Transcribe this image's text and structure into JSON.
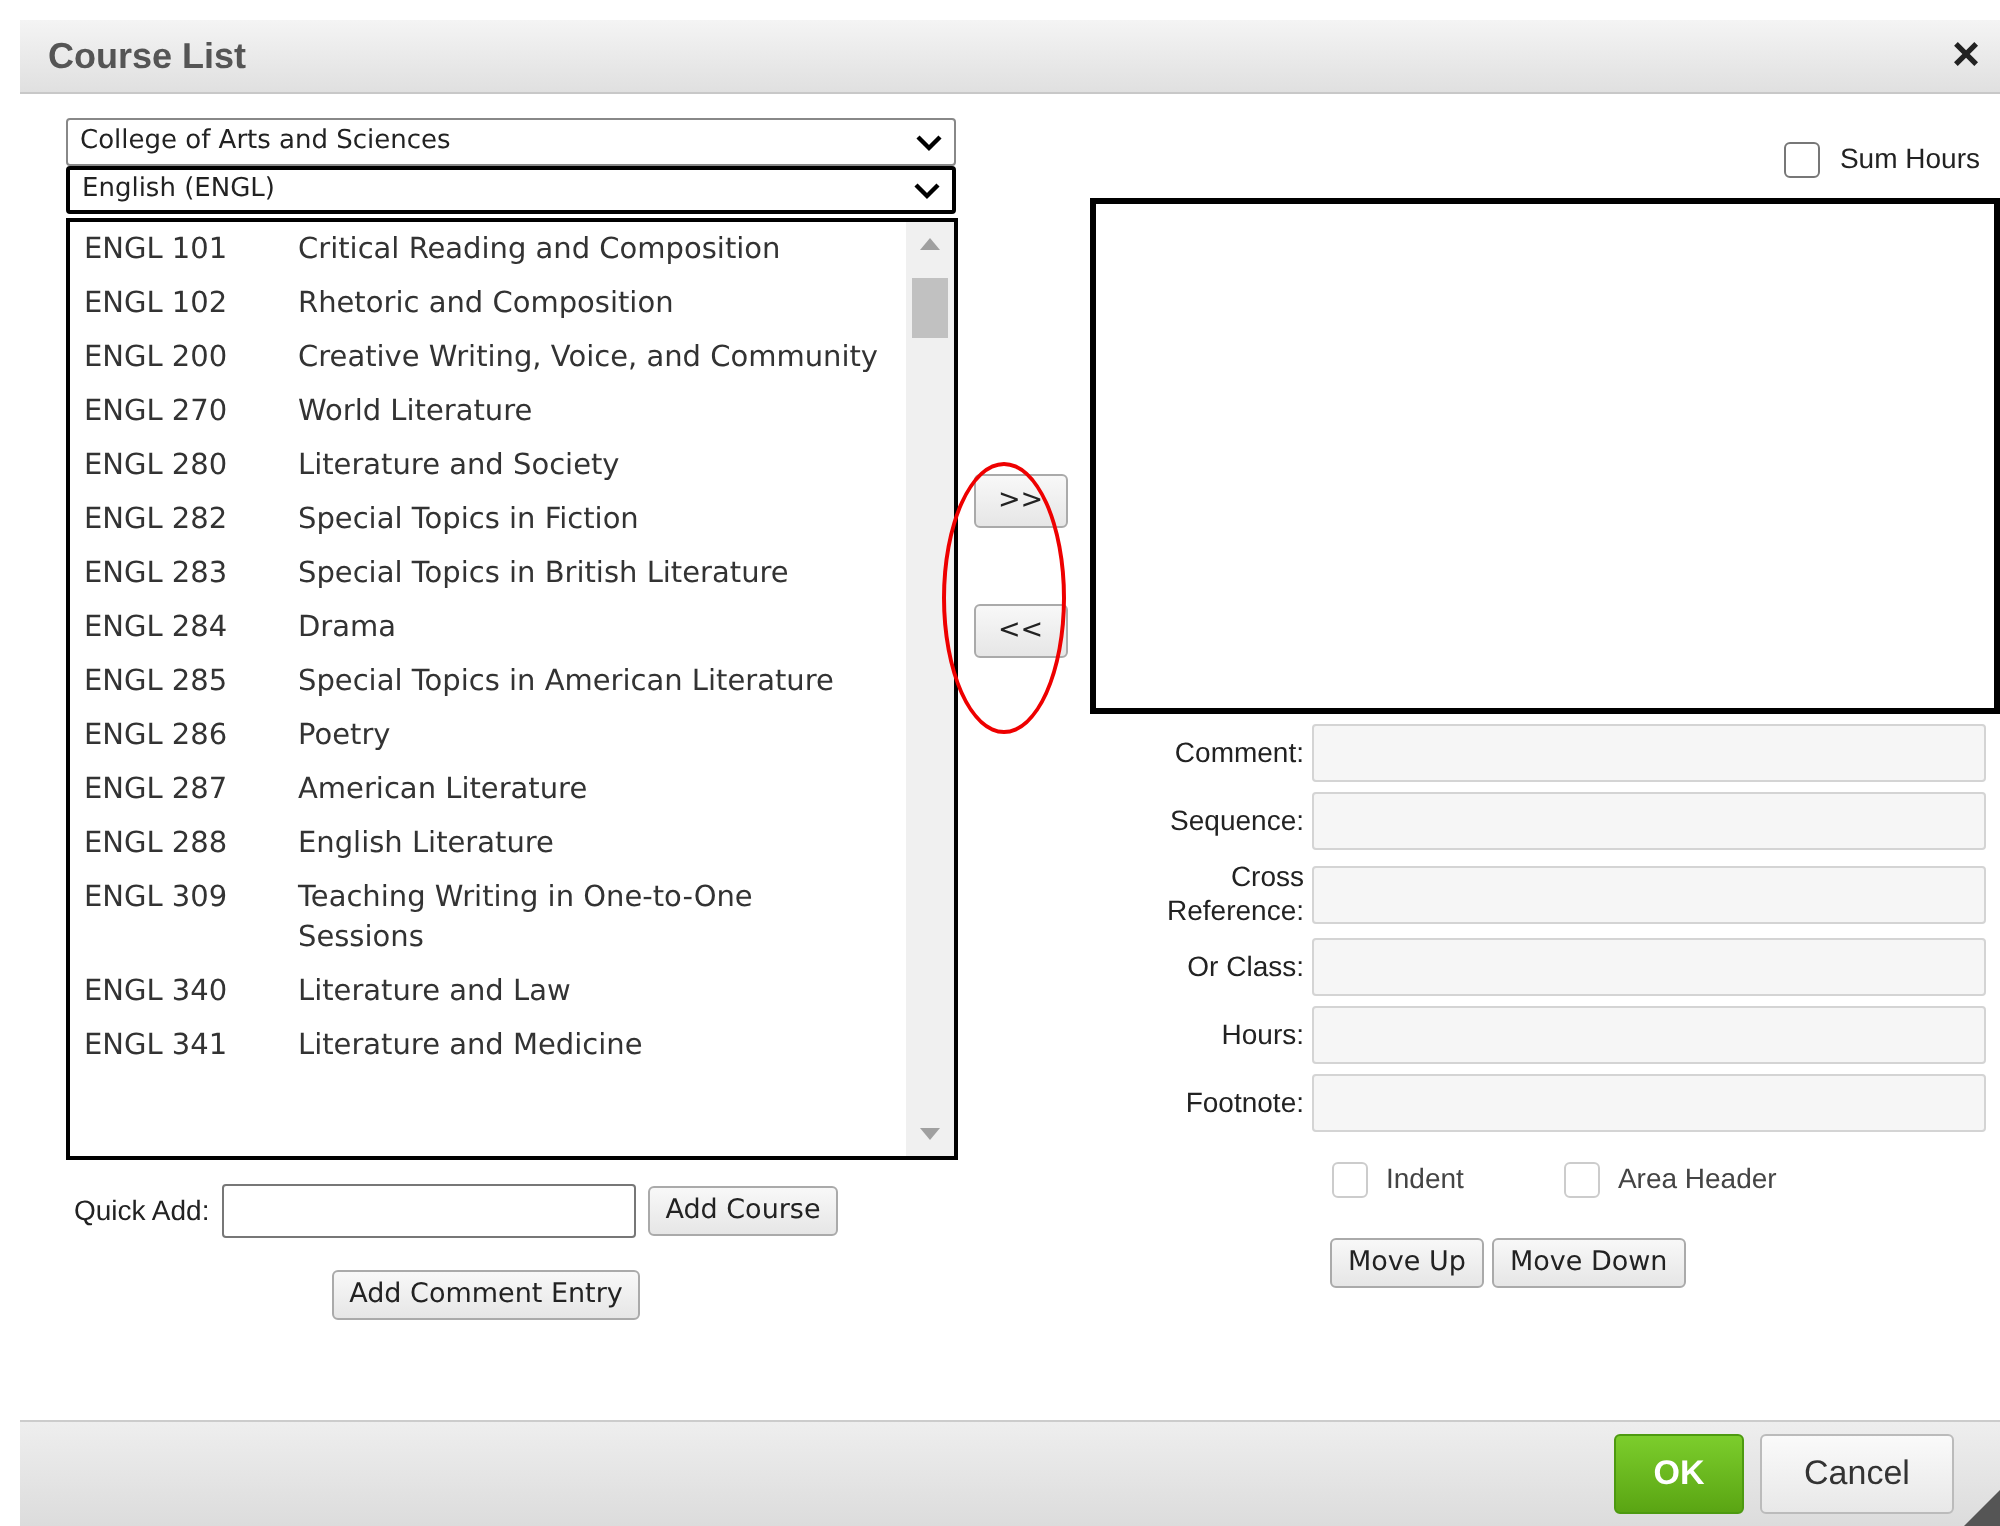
{
  "window": {
    "title": "Course List",
    "close": "×"
  },
  "college_select": {
    "value": "College of Arts and Sciences"
  },
  "subject_select": {
    "value": "English (ENGL)"
  },
  "sum_hours": {
    "label": "Sum Hours",
    "checked": false
  },
  "courses": [
    {
      "code": "ENGL 101",
      "title": "Critical Reading and Composition",
      "selected": false
    },
    {
      "code": "ENGL 102",
      "title": "Rhetoric and Composition",
      "selected": false
    },
    {
      "code": "ENGL 200",
      "title": "Creative Writing, Voice, and Community",
      "selected": false
    },
    {
      "code": "ENGL 270",
      "title": "World Literature",
      "selected": false
    },
    {
      "code": "ENGL 280",
      "title": "Literature and Society",
      "selected": false
    },
    {
      "code": "ENGL 282",
      "title": "Special Topics in Fiction",
      "selected": false
    },
    {
      "code": "ENGL 283",
      "title": "Special Topics in British Literature",
      "selected": false
    },
    {
      "code": "ENGL 284",
      "title": "Drama",
      "selected": false
    },
    {
      "code": "ENGL 285",
      "title": "Special Topics in American Literature",
      "selected": false
    },
    {
      "code": "ENGL 286",
      "title": "Poetry",
      "selected": false
    },
    {
      "code": "ENGL 287",
      "title": "American Literature",
      "selected": false
    },
    {
      "code": "ENGL 288",
      "title": "English Literature",
      "selected": false
    },
    {
      "code": "ENGL 309",
      "title": "Teaching Writing in One-to-One Sessions",
      "selected": false
    },
    {
      "code": "ENGL 340",
      "title": "Literature and Law",
      "selected": false
    },
    {
      "code": "ENGL 341",
      "title": "Literature and Medicine",
      "selected": false
    }
  ],
  "transfer_buttons": [
    {
      "label": ">>",
      "highlighted": true
    },
    {
      "label": "<<",
      "highlighted": true
    }
  ],
  "fields": [
    {
      "label": "Comment:",
      "disabled": true
    },
    {
      "label": "Sequence:",
      "disabled": true
    },
    {
      "label": "Cross Reference:",
      "disabled": true
    },
    {
      "label": "Or Class:",
      "disabled": true
    },
    {
      "label": "Hours:",
      "disabled": true
    },
    {
      "label": "Footnote:",
      "disabled": true
    }
  ],
  "quick_add": {
    "label": "Quick Add:",
    "button": "Add Course"
  },
  "add_comment_button": "Add Comment Entry",
  "options": [
    {
      "label": "Indent",
      "checked": false,
      "disabled": true
    },
    {
      "label": "Area Header",
      "checked": false,
      "disabled": true
    }
  ],
  "move_buttons": [
    "Move Up",
    "Move Down"
  ],
  "footer_buttons": [
    {
      "label": "OK",
      "kind": "primary"
    },
    {
      "label": "Cancel",
      "kind": "secondary"
    }
  ]
}
